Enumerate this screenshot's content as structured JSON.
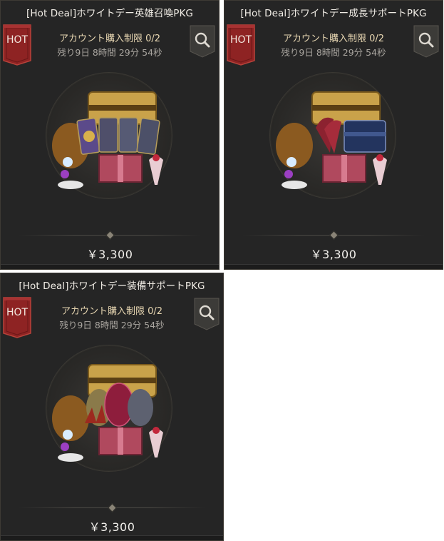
{
  "badge": {
    "label": "HOT"
  },
  "cards": [
    {
      "title": "[Hot Deal]ホワイトデー英雄召喚PKG",
      "limit": "アカウント購入制限 0/2",
      "remaining": "残り9日 8時間 29分 54秒",
      "price": "￥3,300",
      "icon": "magnifier-icon",
      "variant": "hero-cards"
    },
    {
      "title": "[Hot Deal]ホワイトデー成長サポートPKG",
      "limit": "アカウント購入制限 0/2",
      "remaining": "残り9日 8時間 29分 54秒",
      "price": "￥3,300",
      "icon": "magnifier-icon",
      "variant": "growth-chest"
    },
    {
      "title": "[Hot Deal]ホワイトデー装備サポートPKG",
      "limit": "アカウント購入制限 0/2",
      "remaining": "残り9日 8時間 29分 54秒",
      "price": "￥3,300",
      "icon": "magnifier-icon",
      "variant": "equipment-eggs"
    }
  ],
  "colors": {
    "card_bg": "#252525",
    "badge_red": "#8e2323",
    "limit_text": "#e8d7b2",
    "gold": "#c9a24a"
  }
}
